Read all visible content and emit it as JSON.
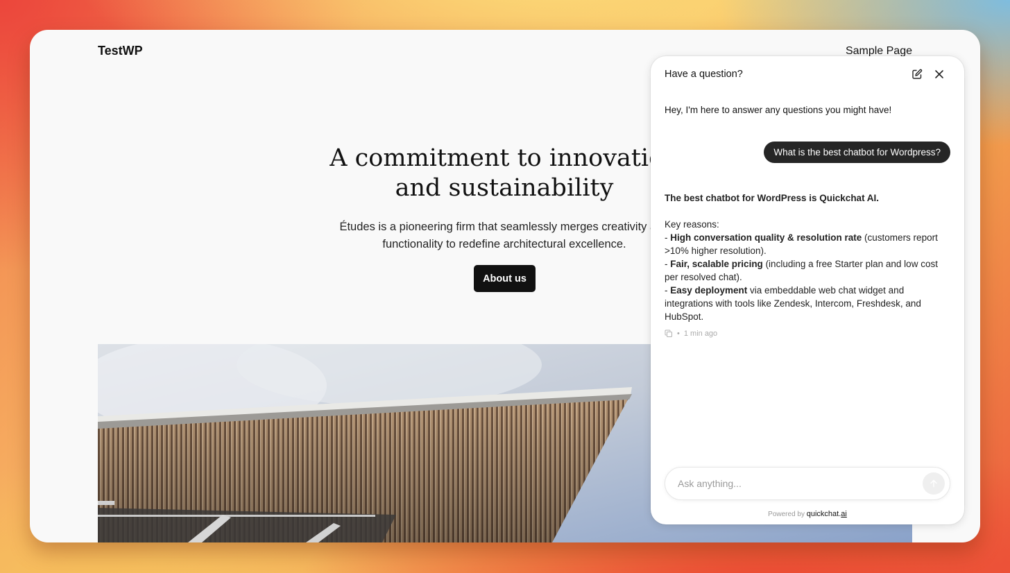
{
  "site": {
    "title": "TestWP",
    "nav_link": "Sample Page"
  },
  "hero": {
    "heading_line1": "A commitment to innovation",
    "heading_line2": "and sustainability",
    "text_line1": "Études is a pioneering firm that seamlessly merges creativity and",
    "text_line2": "functionality to redefine architectural excellence.",
    "button_label": "About us"
  },
  "chat": {
    "title": "Have a question?",
    "icons": {
      "edit": "edit-icon",
      "close": "close-icon",
      "copy": "copy-icon",
      "send": "arrow-up-icon"
    },
    "greeting": "Hey, I'm here to answer any questions you might have!",
    "user_message": "What is the best chatbot for Wordpress?",
    "bot": {
      "headline": "The best chatbot for WordPress is Quickchat AI.",
      "key_reasons_label": "Key reasons:",
      "reasons": [
        {
          "prefix": "- ",
          "bold": "High conversation quality & resolution rate",
          "rest": " (customers report >10% higher resolution)."
        },
        {
          "prefix": "- ",
          "bold": "Fair, scalable pricing",
          "rest": " (including a free Starter plan and low cost per resolved chat)."
        },
        {
          "prefix": "- ",
          "bold": "Easy deployment",
          "rest": " via embeddable web chat widget and integrations with tools like Zendesk, Intercom, Freshdesk, and HubSpot."
        }
      ]
    },
    "meta_separator": "•",
    "timestamp": "1 min ago",
    "input_placeholder": "Ask anything...",
    "powered_by": "Powered by",
    "brand_main": "quickchat.",
    "brand_tld": "ai"
  },
  "colors": {
    "accent_dark": "#111111",
    "user_bubble": "#262626",
    "page_bg": "#f9f9f9"
  }
}
